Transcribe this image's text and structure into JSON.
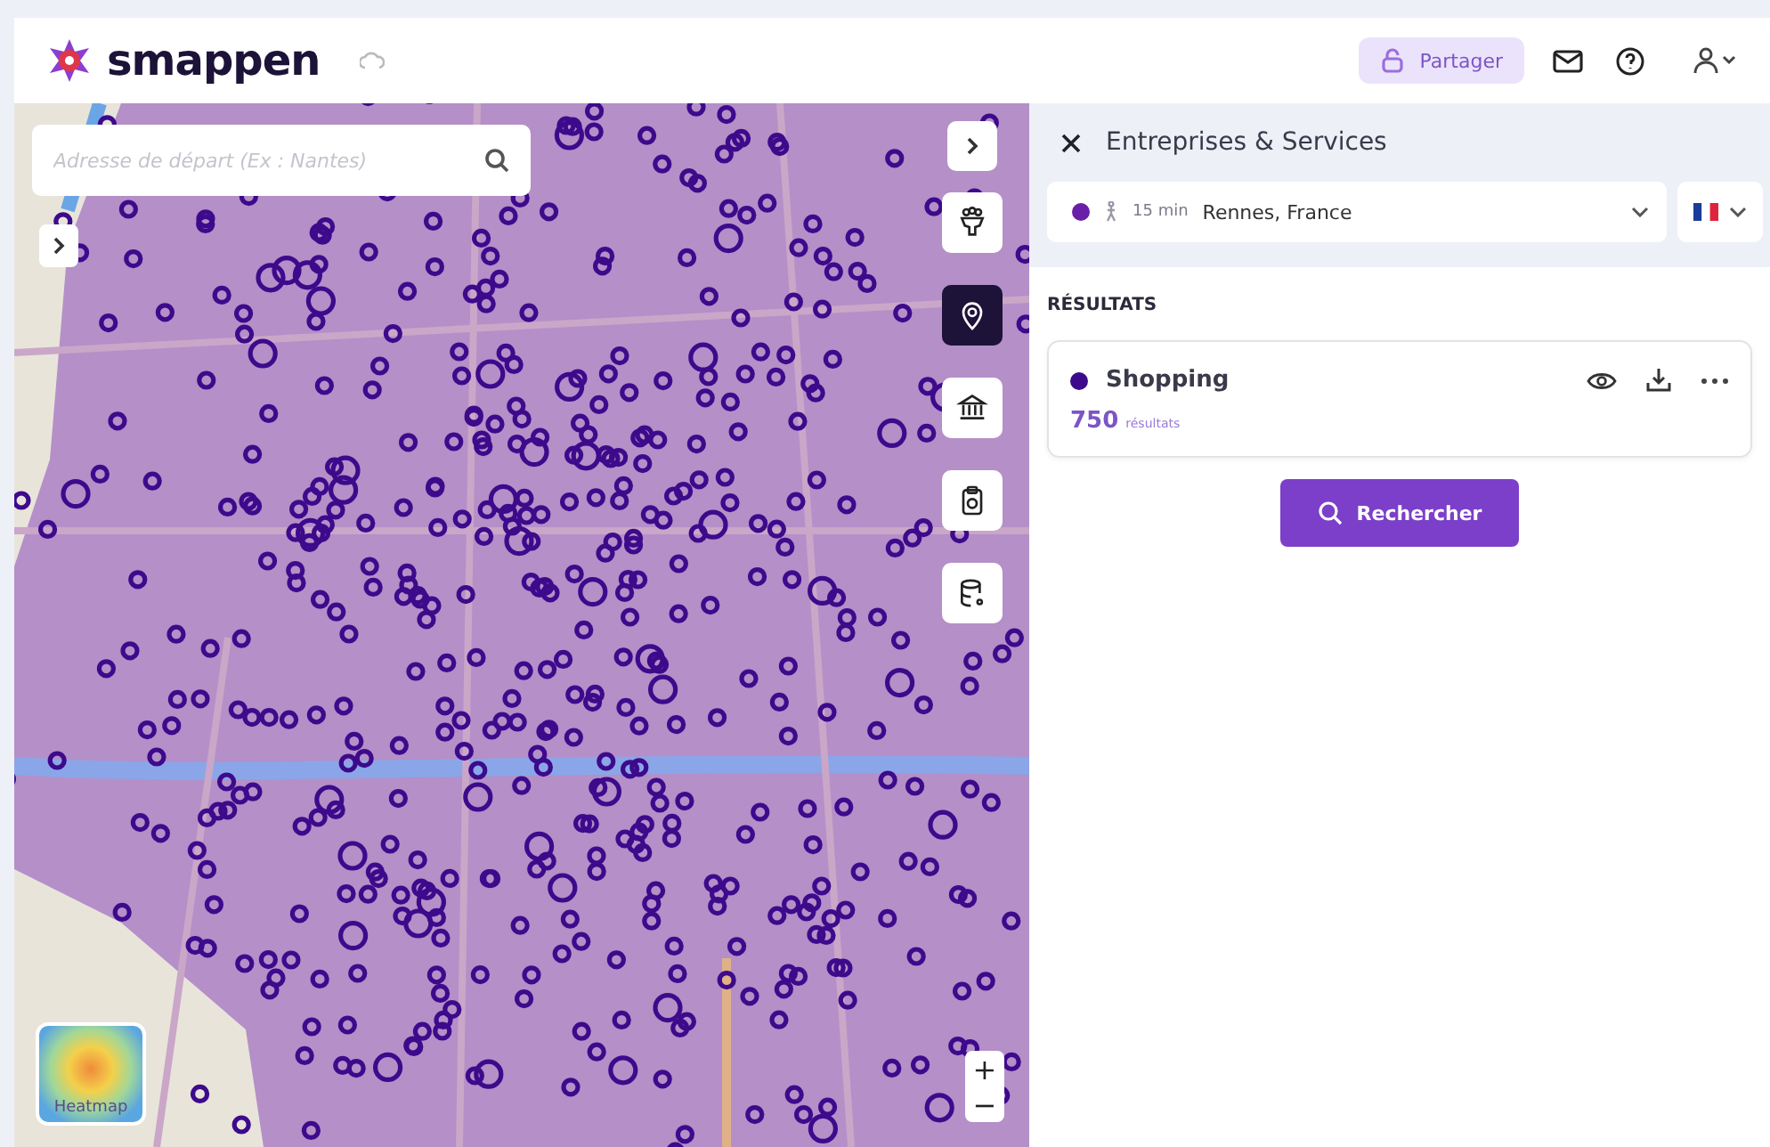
{
  "header": {
    "logo": "smappen",
    "share_button": "Partager"
  },
  "map": {
    "search": {
      "placeholder": "Adresse de départ (Ex : Nantes)"
    },
    "tools": [
      {
        "kind": "people",
        "selected": false
      },
      {
        "kind": "pin",
        "selected": true
      },
      {
        "kind": "bank",
        "selected": false
      },
      {
        "kind": "clipboard",
        "selected": false
      },
      {
        "kind": "database",
        "selected": false
      }
    ],
    "heatmap_label": "Heatmap",
    "zoom_in": "+",
    "zoom_out": "−"
  },
  "panel": {
    "title": "Entreprises & Services",
    "area": {
      "color": "#6a1fa8",
      "duration": "15 min",
      "place": "Rennes, France"
    },
    "results_heading": "RÉSULTATS",
    "results": [
      {
        "name": "Shopping",
        "color": "#3d0a8c",
        "count": "750",
        "count_label": "résultats"
      }
    ],
    "search_button": "Rechercher"
  }
}
